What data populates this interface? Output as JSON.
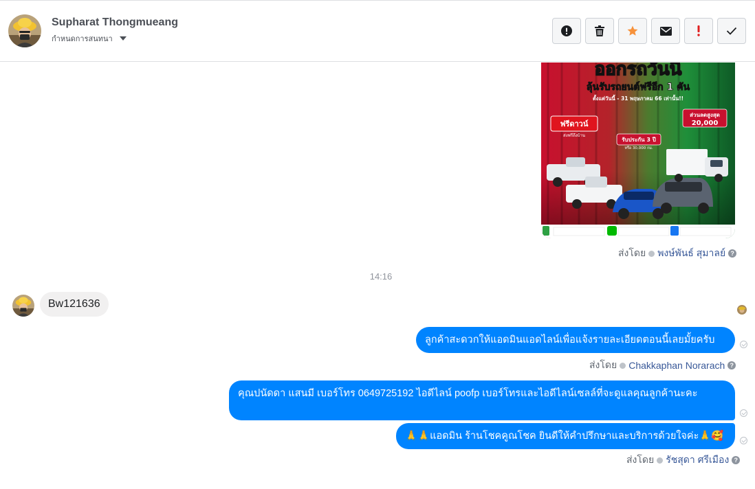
{
  "header": {
    "name": "Supharat Thongmueang",
    "subtitle": "กำหนดการสนทนา",
    "toolbar": [
      {
        "icon": "alert-circle-icon"
      },
      {
        "icon": "trash-icon"
      },
      {
        "icon": "star-icon",
        "color": "#f7923b"
      },
      {
        "icon": "envelope-icon"
      },
      {
        "icon": "exclamation-icon",
        "color": "#e02020"
      },
      {
        "icon": "checkmark-icon"
      }
    ]
  },
  "promo": {
    "headline": "ออกรถวันนี้",
    "subheadline": "ลุ้นรับรถยนต์ฟรีอีก 1 คัน",
    "dateline": "ตั้งแต่วันนี้ - 31 พฤษภาคม 66 เท่านั้น!!",
    "badge_free": "ฟรีดาวน์",
    "badge_free_sub": "ส่งฟรีถึงบ้าน",
    "badge_warranty": "รับประกัน 3 ปี",
    "badge_warranty_sub": "หรือ 30,000 กม.",
    "badge_discount": "ส่วนลดสูงสุด",
    "badge_discount_value": "20,000",
    "colors": {
      "red": "#c8102e",
      "green": "#1f8f3a"
    }
  },
  "messages": {
    "promo_sent_by_label": "ส่งโดย",
    "promo_sent_by_name": "พงษ์พันธ์ สุมาลย์",
    "timestamp": "14:16",
    "incoming_text": "Bw121636",
    "out1_text": "ลูกค้าสะดวกให้แอดมินแอดไลน์เพื่อแจ้งรายละเอียดตอนนี้เลยมั้ยครับ",
    "out1_sent_by_label": "ส่งโดย",
    "out1_sent_by_name": "Chakkaphan Norarach",
    "out2_text": "คุณปนัดดา แสนมี   เบอร์โทร 0649725192  ไอดีไลน์ poofp   เบอร์โทรและไอดีไลน์เซลล์ที่จะดูแลคุณลูกค้านะคะ",
    "out3_text": "🙏🙏แอดมิน ร้านโชคคูณโชค ยินดีให้คำปรึกษาและบริการด้วยใจค่ะ🙏🥰",
    "out3_sent_by_label": "ส่งโดย",
    "out3_sent_by_name": "รัชสุดา ศรีเมือง",
    "bubble_color": "#0084ff"
  }
}
